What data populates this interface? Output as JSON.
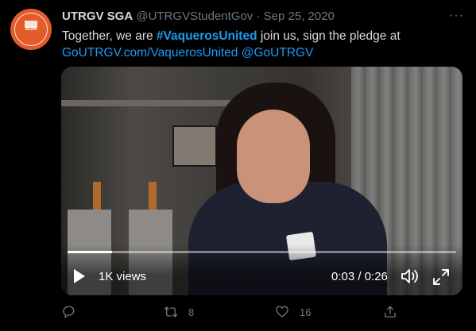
{
  "tweet": {
    "author_name": "UTRGV SGA",
    "handle": "@UTRGVStudentGov",
    "separator": "·",
    "date": "Sep 25, 2020",
    "more_label": "···",
    "avatar_text": "SGA",
    "text_part1": "Together, we are ",
    "hashtag": "#VaquerosUnited",
    "text_part2": " join us, sign the pledge at ",
    "link_url": "GoUTRGV.com/VaquerosUnited",
    "mention": "@GoUTRGV"
  },
  "video": {
    "views": "1K views",
    "time": "0:03 / 0:26",
    "progress": 0.115
  },
  "actions": {
    "reply_count": "",
    "retweet_count": "8",
    "like_count": "16"
  },
  "colors": {
    "background": "#000000",
    "link": "#1d9bf0",
    "muted": "#6e767d",
    "avatar": "#e35a2b"
  }
}
